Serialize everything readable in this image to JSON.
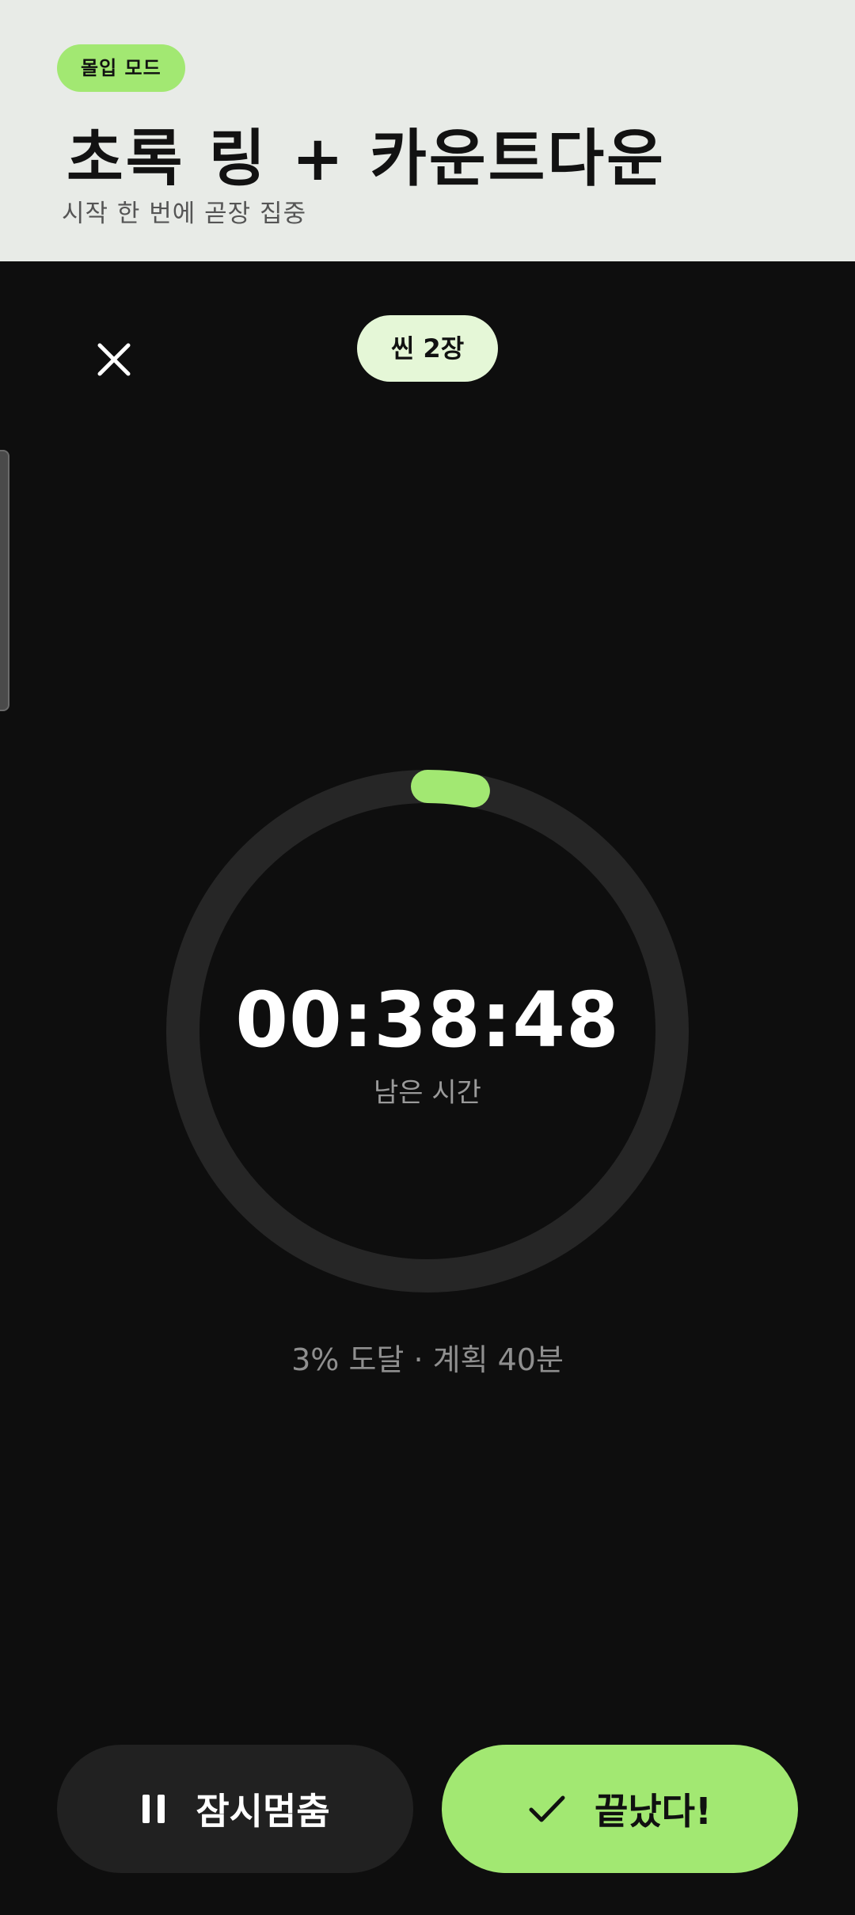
{
  "header": {
    "mode_badge": "몰입 모드",
    "title": "초록 링 + 카운트다운",
    "subtitle": "시작 한 번에 곧장 집중"
  },
  "top_bar": {
    "close_icon": "close-icon",
    "scene_chip": "씬 2장"
  },
  "timer": {
    "remaining": "00:38:48",
    "label": "남은 시간",
    "progress_fraction": 0.03,
    "ring_color": "#a2e872",
    "track_color": "#262626"
  },
  "progress_text": "3% 도달 · 계획 40분",
  "actions": {
    "pause_icon": "pause-icon",
    "pause_label": "잠시멈춤",
    "done_icon": "check-icon",
    "done_label": "끝났다!"
  },
  "colors": {
    "accent": "#a2e872",
    "background": "#0e0e0e",
    "header_bg": "#e8ebe7"
  }
}
